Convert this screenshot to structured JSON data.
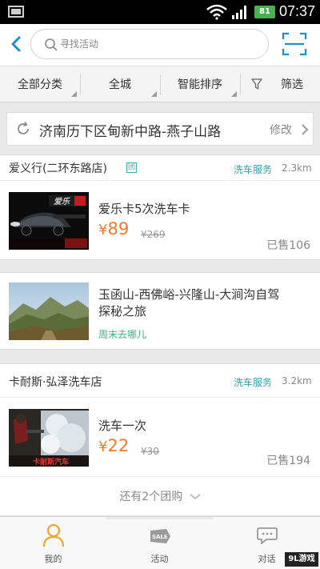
{
  "status_bar": {
    "time": "07:37",
    "battery": "81"
  },
  "search": {
    "placeholder": "寻找活动"
  },
  "filters": {
    "category": "全部分类",
    "city": "全城",
    "sort": "智能排序",
    "filter": "筛选"
  },
  "location": {
    "address": "济南历下区甸新中路-燕子山路",
    "modify": "修改"
  },
  "shops": [
    {
      "name": "爱义行(二环东路店)",
      "badge": "团",
      "category": "洗车服务",
      "distance": "2.3km",
      "deal": {
        "title": "爱乐卡5次洗车卡",
        "price_symbol": "¥",
        "price": "89",
        "old_price": "¥269",
        "sold": "已售106"
      }
    },
    {
      "name": "卡耐斯·弘泽洗车店",
      "category": "洗车服务",
      "distance": "3.2km",
      "deal": {
        "title": "洗车一次",
        "price_symbol": "¥",
        "price": "22",
        "old_price": "¥30",
        "sold": "已售194"
      },
      "more": "还有2个团购"
    }
  ],
  "activity": {
    "title_line1": "玉函山-西佛峪-兴隆山-大涧沟自驾",
    "title_line2": "探秘之旅",
    "tag": "周末去哪儿"
  },
  "tabs": [
    {
      "label": "我的"
    },
    {
      "label": "活动"
    },
    {
      "label": "对话"
    }
  ],
  "watermark": "9L游戏",
  "colors": {
    "accent": "#1a8fd4",
    "price": "#f27a2c",
    "category": "#2fa3a8",
    "tag": "#38b38c",
    "tab_active": "#f0a531"
  }
}
